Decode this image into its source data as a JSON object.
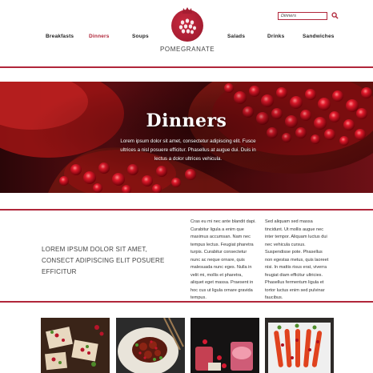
{
  "site": {
    "logo_text": "POMEGRANATE",
    "accent_color": "#b0263a"
  },
  "nav": {
    "items": [
      {
        "label": "Breakfasts",
        "active": false
      },
      {
        "label": "Dinners",
        "active": true
      },
      {
        "label": "Soups",
        "active": false
      },
      {
        "label": "Salads",
        "active": false
      },
      {
        "label": "Drinks",
        "active": false
      },
      {
        "label": "Sandwiches",
        "active": false
      }
    ]
  },
  "search": {
    "value": "Dinners",
    "icon": "search-icon"
  },
  "hero": {
    "title": "Dinners",
    "text": "Lorem ipsum dolor sit amet, consectetur adipiscing elit. Fusce ultrices a nisl posuere efficitur. Phasellus at augue dui. Duis in lectus a dolor ultrices vehicula."
  },
  "intro": {
    "heading": "LOREM IPSUM DOLOR SIT AMET, CONSECT ADIPISCING ELIT POSUERE EFFICITUR",
    "column1": "Cras eu mi nec ante blandit dapi. Curabitur ligula a enim que maximus accumsan. Nam nec tempus lectus. Feugiat pharetra turpis. Curabitur consectetur nunc ac neque ornare, quis malesuada nunc eges. Nulla in velit mi, mollis et pharetra, aliquet eget massa. Praesent in hoc cus ut ligula ornare gravida tempus.",
    "column2": "Sed aliquam sed massa tincidunt. Ut mollis augue nec inter tempor. Aliquam luctus dui nec vehicula cursus. Suspendisse pote. Phasellus non egestas metus, quis laoreet nisi. In mattis risus erat, viverra feugiat diam efficitur ultricies. Phasellus fermentum ligula et tortor luctus enim sed pulvinar faucibus."
  },
  "thumbnails": [
    {
      "label": "dish-1"
    },
    {
      "label": "dish-2"
    },
    {
      "label": "dish-3"
    },
    {
      "label": "dish-4"
    }
  ]
}
